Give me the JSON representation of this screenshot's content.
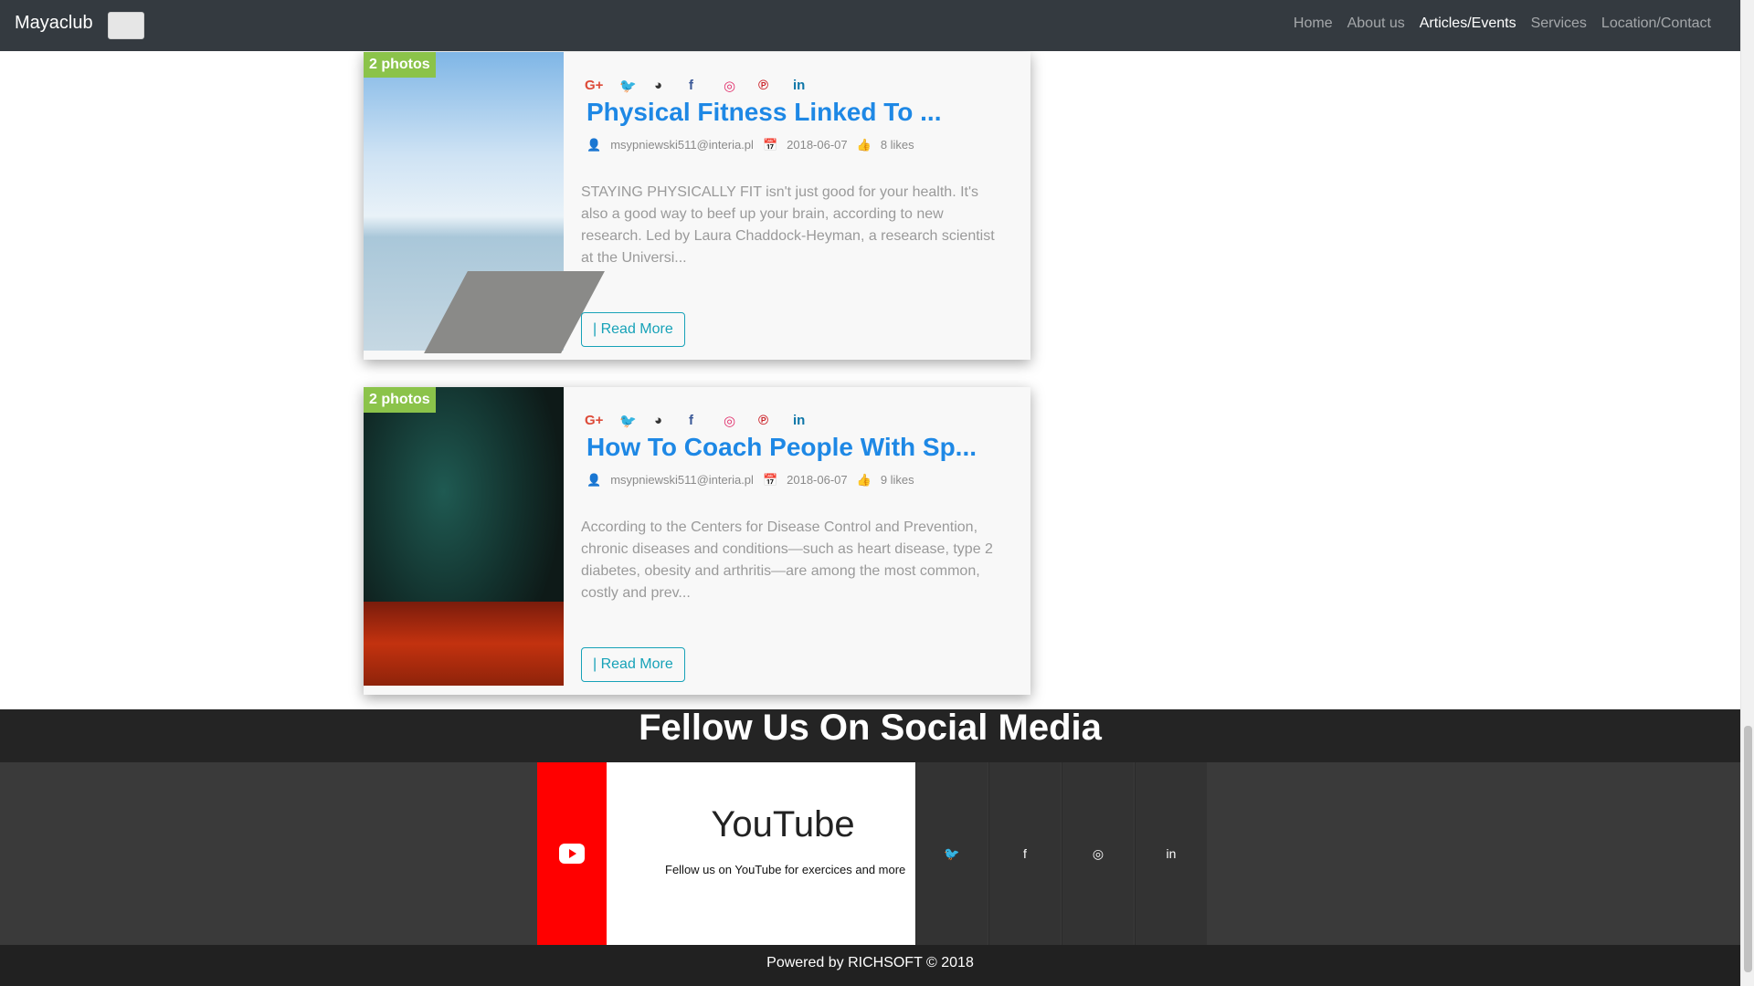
{
  "navbar": {
    "brand": "Mayaclub",
    "links": [
      "Home",
      "About us",
      "Articles/Events",
      "Services",
      "Location/Contact"
    ],
    "active_link": "Articles/Events"
  },
  "social_icons": [
    "google-plus-icon",
    "twitter-icon",
    "github-icon",
    "facebook-icon",
    "instagram-icon",
    "pinterest-icon",
    "linkedin-icon"
  ],
  "social_glyphs": {
    "g": "G+",
    "t": "🐦",
    "gh": "◕",
    "f": "f",
    "i": "◎",
    "p": "℗",
    "l": "in"
  },
  "articles": [
    {
      "badge": "2 photos",
      "title": "Physical Fitness Linked To ...",
      "author": "msypniewski511@interia.pl",
      "date": "2018-06-07",
      "likes": "8 likes",
      "excerpt": "STAYING PHYSICALLY FIT isn't just good for your health. It's also a good way to beef up your brain, according to new research. Led by Laura Chaddock-Heyman, a research scientist at the Universi...",
      "read_more": "| Read More"
    },
    {
      "badge": "2 photos",
      "title": "How To Coach People With Sp...",
      "author": "msypniewski511@interia.pl",
      "date": "2018-06-07",
      "likes": "9 likes",
      "excerpt": "According to the Centers for Disease Control and Prevention, chronic diseases and conditions—such as heart disease, type 2 diabetes, obesity and arthritis—are among the most common, costly and prev...",
      "read_more": "| Read More"
    }
  ],
  "footer": {
    "follow_title": "Fellow Us On Social Media",
    "youtube_name": "YouTube",
    "youtube_desc": "Fellow us on YouTube for exercices and more",
    "tile_glyphs": {
      "twitter": "🐦",
      "facebook": "f",
      "instagram": "◎",
      "linkedin": "in"
    },
    "powered": "Powered by RICHSOFT © 2018"
  },
  "colors": {
    "navbar_bg": "#343a40",
    "title_blue": "#1e88e5",
    "badge_green": "#8bc34a",
    "youtube_red": "#ff0000",
    "read_more_teal": "#17a2b8"
  }
}
